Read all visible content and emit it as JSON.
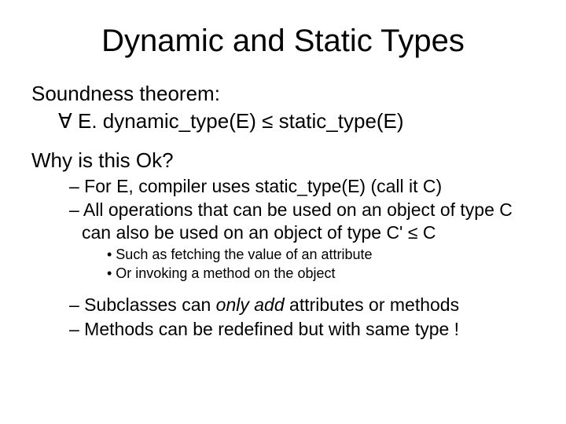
{
  "title": "Dynamic and Static Types",
  "line1": "Soundness theorem:",
  "line2_forall": "∀",
  "line2_a": " E.   dynamic_type(E)  ",
  "line2_le": "≤",
  "line2_b": "  static_type(E)",
  "line3": "Why is this Ok?",
  "b1": "– For E, compiler uses static_type(E) (call it C)",
  "b2a": "– All operations that can be used on an object of type C can also be used on an object of type C' ",
  "b2_le": "≤",
  "b2b": " C",
  "s1": "• Such as fetching the value of an attribute",
  "s2": "• Or invoking a method on the object",
  "b3a": "– Subclasses can ",
  "b3b": "only add",
  "b3c": " attributes or methods",
  "b4": "– Methods can be redefined but with same type !"
}
